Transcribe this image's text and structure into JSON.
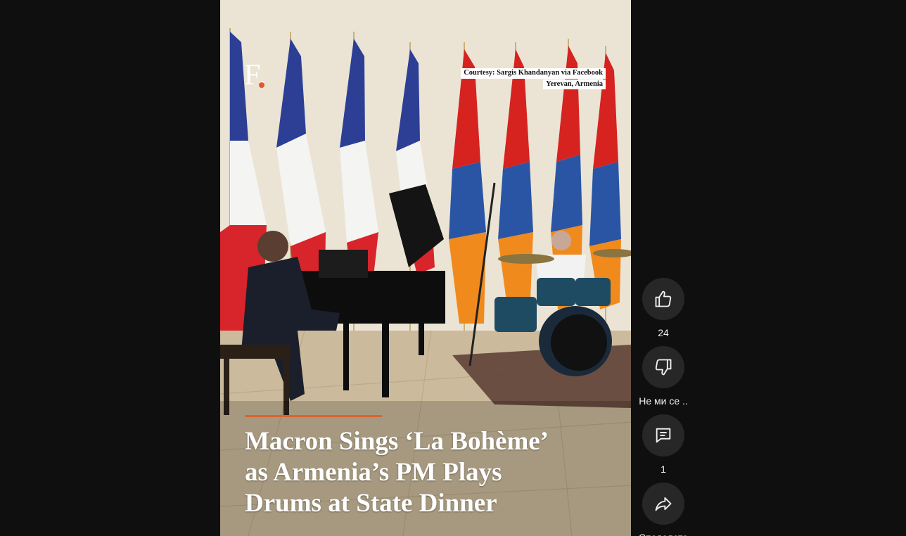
{
  "video": {
    "logo": "F.",
    "courtesy_line1": "Courtesy: Sargis Khandanyan via Facebook",
    "courtesy_line2": "Yerevan, Armenia",
    "title_line1": "Macron Sings ‘La Bohème’",
    "title_line2": "as Armenia’s PM Plays",
    "title_line3": "Drums at State Dinner"
  },
  "actions": {
    "like": {
      "icon": "thumbs-up-icon",
      "label": "24"
    },
    "dislike": {
      "icon": "thumbs-down-icon",
      "label": "Не ми се .."
    },
    "comments": {
      "icon": "comment-icon",
      "label": "1"
    },
    "share": {
      "icon": "share-icon",
      "label": "Споделете"
    }
  },
  "colors": {
    "page_background": "#0f0f0f",
    "button_background": "#272727",
    "accent_rule": "#d9642f",
    "logo_dot": "#e4572e"
  }
}
